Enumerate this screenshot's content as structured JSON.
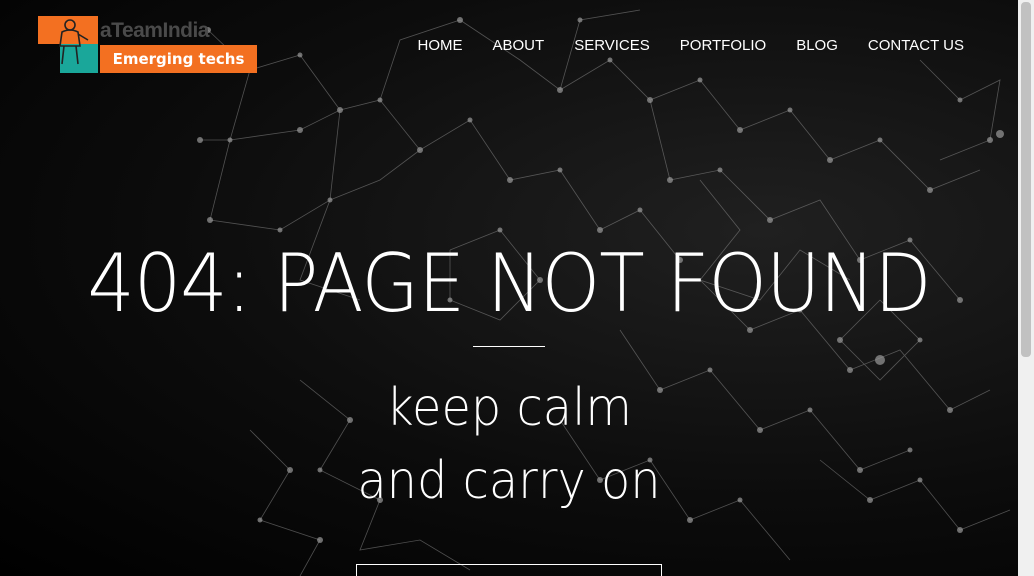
{
  "logo": {
    "brand": "aTeamIndia",
    "tagline": "Emerging techs",
    "colors": {
      "orange": "#f37021",
      "teal": "#1aa79a"
    }
  },
  "nav": {
    "items": [
      {
        "label": "HOME"
      },
      {
        "label": "ABOUT"
      },
      {
        "label": "SERVICES"
      },
      {
        "label": "PORTFOLIO"
      },
      {
        "label": "BLOG"
      },
      {
        "label": "CONTACT US"
      }
    ]
  },
  "hero": {
    "title": "404: PAGE NOT FOUND",
    "line1": "keep calm",
    "line2": "and carry on",
    "button_label": ""
  },
  "colors": {
    "background": "#000000",
    "text": "#ffffff"
  }
}
